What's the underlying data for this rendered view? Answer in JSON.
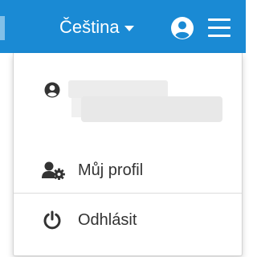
{
  "header": {
    "language_label": "Čeština",
    "bar_color": "#1a8ad4"
  },
  "icons": {
    "user_button": "user-circle-icon",
    "menu_button": "hamburger-menu-icon",
    "user_row": "user-circle-icon",
    "profile": "user-gear-icon",
    "logout": "power-icon"
  },
  "dropdown": {
    "profile_label": "Můj profil",
    "logout_label": "Odhlásit"
  }
}
